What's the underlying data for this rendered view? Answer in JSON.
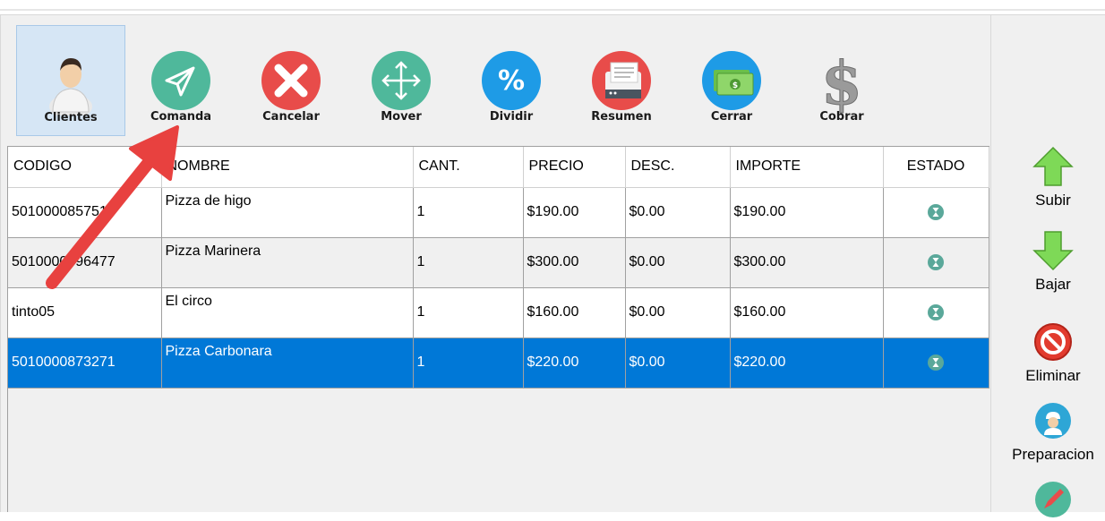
{
  "toolbar": {
    "buttons": [
      {
        "label": "Clientes",
        "icon": "customer-icon"
      },
      {
        "label": "Comanda",
        "icon": "send-icon"
      },
      {
        "label": "Cancelar",
        "icon": "cancel-icon"
      },
      {
        "label": "Mover",
        "icon": "move-icon"
      },
      {
        "label": "Dividir",
        "icon": "percent-icon"
      },
      {
        "label": "Resumen",
        "icon": "printer-icon"
      },
      {
        "label": "Cerrar",
        "icon": "cash-icon"
      },
      {
        "label": "Cobrar",
        "icon": "dollar-icon"
      }
    ]
  },
  "table": {
    "columns": [
      "CODIGO",
      "NOMBRE",
      "CANT.",
      "PRECIO",
      "DESC.",
      "IMPORTE",
      "ESTADO"
    ],
    "rows": [
      {
        "codigo": "5010000857513",
        "nombre": "Pizza de higo",
        "cant": "1",
        "precio": "$190.00",
        "desc": "$0.00",
        "importe": "$190.00",
        "estado": "hourglass-icon"
      },
      {
        "codigo": "5010000596477",
        "nombre": "Pizza Marinera",
        "cant": "1",
        "precio": "$300.00",
        "desc": "$0.00",
        "importe": "$300.00",
        "estado": "hourglass-icon"
      },
      {
        "codigo": "tinto05",
        "nombre": "El circo",
        "cant": "1",
        "precio": "$160.00",
        "desc": "$0.00",
        "importe": "$160.00",
        "estado": "hourglass-icon"
      },
      {
        "codigo": "5010000873271",
        "nombre": "Pizza Carbonara",
        "cant": "1",
        "precio": "$220.00",
        "desc": "$0.00",
        "importe": "$220.00",
        "estado": "hourglass-icon"
      }
    ],
    "selected_row": 3
  },
  "sidebar": {
    "buttons": [
      {
        "label": "Subir",
        "icon": "arrow-up-icon"
      },
      {
        "label": "Bajar",
        "icon": "arrow-down-icon"
      },
      {
        "label": "Eliminar",
        "icon": "delete-icon"
      },
      {
        "label": "Preparacion",
        "icon": "chef-icon"
      },
      {
        "label": "",
        "icon": "edit-icon"
      }
    ]
  },
  "colors": {
    "selection": "#0078d7",
    "annotation_arrow": "#e8413f",
    "active_toolbar": "#d6e6f5"
  }
}
